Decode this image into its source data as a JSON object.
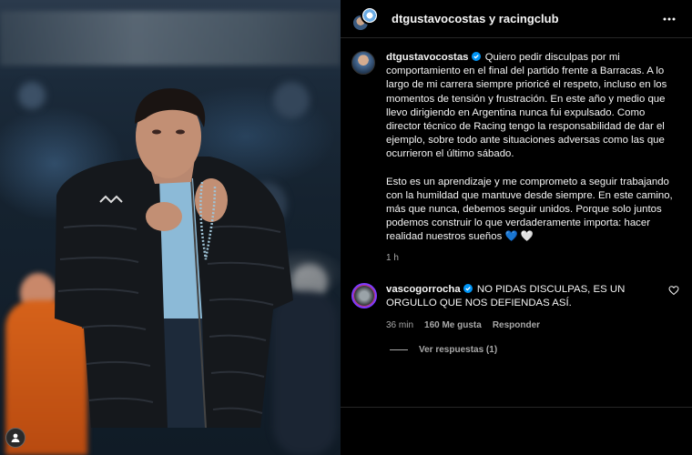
{
  "header": {
    "user1": "dtgustavocostas",
    "conjunction": "y",
    "user2": "racingclub"
  },
  "caption": {
    "username": "dtgustavocostas",
    "paragraph1": "Quiero pedir disculpas por mi comportamiento en el final del partido frente a Barracas. A lo largo de mi carrera siempre prioricé el respeto, incluso en los momentos de tensión y frustración. En este año y medio que llevo dirigiendo en Argentina nunca fui expulsado. Como director técnico de Racing tengo la responsabilidad de dar el ejemplo, sobre todo ante situaciones adversas como las que ocurrieron el último sábado.",
    "paragraph2": "Esto es un aprendizaje y me comprometo a seguir trabajando con la humildad que mantuve desde siempre. En este camino, más que nunca, debemos seguir unidos. Porque solo juntos podemos construir lo que verdaderamente importa: hacer realidad nuestros sueños",
    "emojis": "💙 🤍",
    "time": "1 h"
  },
  "comment": {
    "username": "vascogorrocha",
    "text": "NO PIDAS DISCULPAS, ES UN ORGULLO QUE NOS DEFIENDAS ASÍ.",
    "time": "36 min",
    "likes": "160 Me gusta",
    "reply": "Responder",
    "view_replies": "Ver respuestas (1)"
  },
  "icons": {
    "more": "more-horizontal-icon",
    "verified": "verified-badge-icon",
    "heart": "heart-outline-icon"
  },
  "colors": {
    "verified": "#0095f6",
    "background": "#000000",
    "secondary_text": "#a8a8a8"
  }
}
